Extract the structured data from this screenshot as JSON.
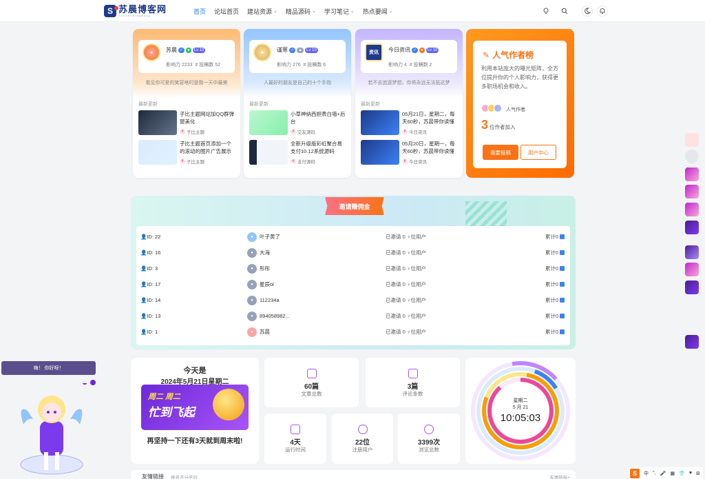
{
  "header": {
    "logo_text": "苏晨博客网",
    "logo_sub": "SuChenBlogWang",
    "nav": [
      {
        "label": "首页",
        "active": true,
        "dropdown": false
      },
      {
        "label": "论坛首页",
        "active": false,
        "dropdown": false
      },
      {
        "label": "建站资源",
        "active": false,
        "dropdown": true
      },
      {
        "label": "精品源码",
        "active": false,
        "dropdown": true
      },
      {
        "label": "学习笔记",
        "active": false,
        "dropdown": true
      },
      {
        "label": "热点要闻",
        "active": false,
        "dropdown": true
      }
    ],
    "icons": [
      "bulb-icon",
      "search-icon",
      "moon-icon",
      "bell-icon"
    ]
  },
  "users": [
    {
      "name": "苏晨",
      "level": "10",
      "influence": "影响力 2233",
      "posts": "# 投稿数 52",
      "motto": "看见你可爱的笑容啥时是我一天中最美",
      "recent_label": "最新更新",
      "posts_list": [
        {
          "title": "子比主题网站加QQ群弹窗美化",
          "cat": "子比主题"
        },
        {
          "title": "子比主题首页添加一个的滚动的图片广告展示",
          "cat": "子比主题"
        }
      ],
      "color": "#fdba74"
    },
    {
      "name": "谨寒",
      "level": "10",
      "influence": "影响力 276",
      "posts": "# 投稿数 6",
      "motto": "人最好的朋友是自己的十个手指",
      "recent_label": "最新更新",
      "posts_list": [
        {
          "title": "小草神纳西妲表白墙+后台",
          "cat": "交友源码"
        },
        {
          "title": "全新升级版彩虹聚合易支付10.12系统源码",
          "cat": "支付源码"
        }
      ],
      "color": "#93c5fd"
    },
    {
      "name": "今日资讯",
      "level": "10",
      "influence": "影响力 4",
      "posts": "# 投稿数 2",
      "motto": "若不去追逐梦想，你将永远无法抵达梦",
      "recent_label": "最新更新",
      "posts_list": [
        {
          "title": "05月21日，星期二，每天60秒，苏晨带你读懂",
          "cat": "今日资讯"
        },
        {
          "title": "05月20日，星期一，每天60秒，苏晨带你读懂",
          "cat": "今日资讯"
        }
      ],
      "color": "#c4b5fd"
    }
  ],
  "ranking": {
    "title": "人气作者榜",
    "desc": "利用本站庞大的曝光矩阵，全方位提升你的个人影响力，获得更多职场机会和收入。",
    "avatars_label": "人气作者",
    "count": "3",
    "count_label": "位作者加入",
    "btn_submit": "我要投稿",
    "btn_user": "用户中心"
  },
  "invite": {
    "title": "邀请赚佣金",
    "rows": [
      {
        "id": "ID: 22",
        "user": "叶子黄了",
        "invited": "已邀请 0 ♀位用户",
        "total": "累计0"
      },
      {
        "id": "ID: 16",
        "user": "大海",
        "invited": "已邀请 0 ♀位用户",
        "total": "累计0"
      },
      {
        "id": "ID: 3",
        "user": "彤彤",
        "invited": "已邀请 0 ♀位用户",
        "total": "累计0"
      },
      {
        "id": "ID: 17",
        "user": "星辰ol",
        "invited": "已邀请 0 ♀位用户",
        "total": "累计0"
      },
      {
        "id": "ID: 14",
        "user": "112234a",
        "invited": "已邀请 0 ♀位用户",
        "total": "累计0"
      },
      {
        "id": "ID: 13",
        "user": "894058982...",
        "invited": "已邀请 0 ♀位用户",
        "total": "累计0"
      },
      {
        "id": "ID: 1",
        "user": "苏晨",
        "invited": "已邀请 0 ♀位用户",
        "total": "累计0"
      }
    ]
  },
  "today": {
    "line1": "今天是",
    "line2": "2024年5月21日星期二",
    "pic_text1": "周二 周二",
    "pic_text2": "忙到飞起",
    "line3": "再坚持一下还有3天就到周末啦!"
  },
  "stats": [
    {
      "value": "60篇",
      "label": "文章总数"
    },
    {
      "value": "3篇",
      "label": "评论条数"
    },
    {
      "value": "4天",
      "label": "运行时间"
    },
    {
      "value": "22位",
      "label": "注册用户"
    },
    {
      "value": "3399次",
      "label": "浏览总数"
    }
  ],
  "clock": {
    "weekday": "星期二",
    "date": "5 月 21",
    "time": "10:05:03"
  },
  "friend": {
    "label": "友情链接",
    "sub": "排名不分先后",
    "more": "友情链接+"
  },
  "mascot": {
    "greeting": "嗨！ 你好呀！"
  },
  "ime": {
    "items": [
      "S",
      "中",
      "°,",
      "🎤",
      "▦",
      "👕",
      "♥",
      "⊞"
    ]
  }
}
